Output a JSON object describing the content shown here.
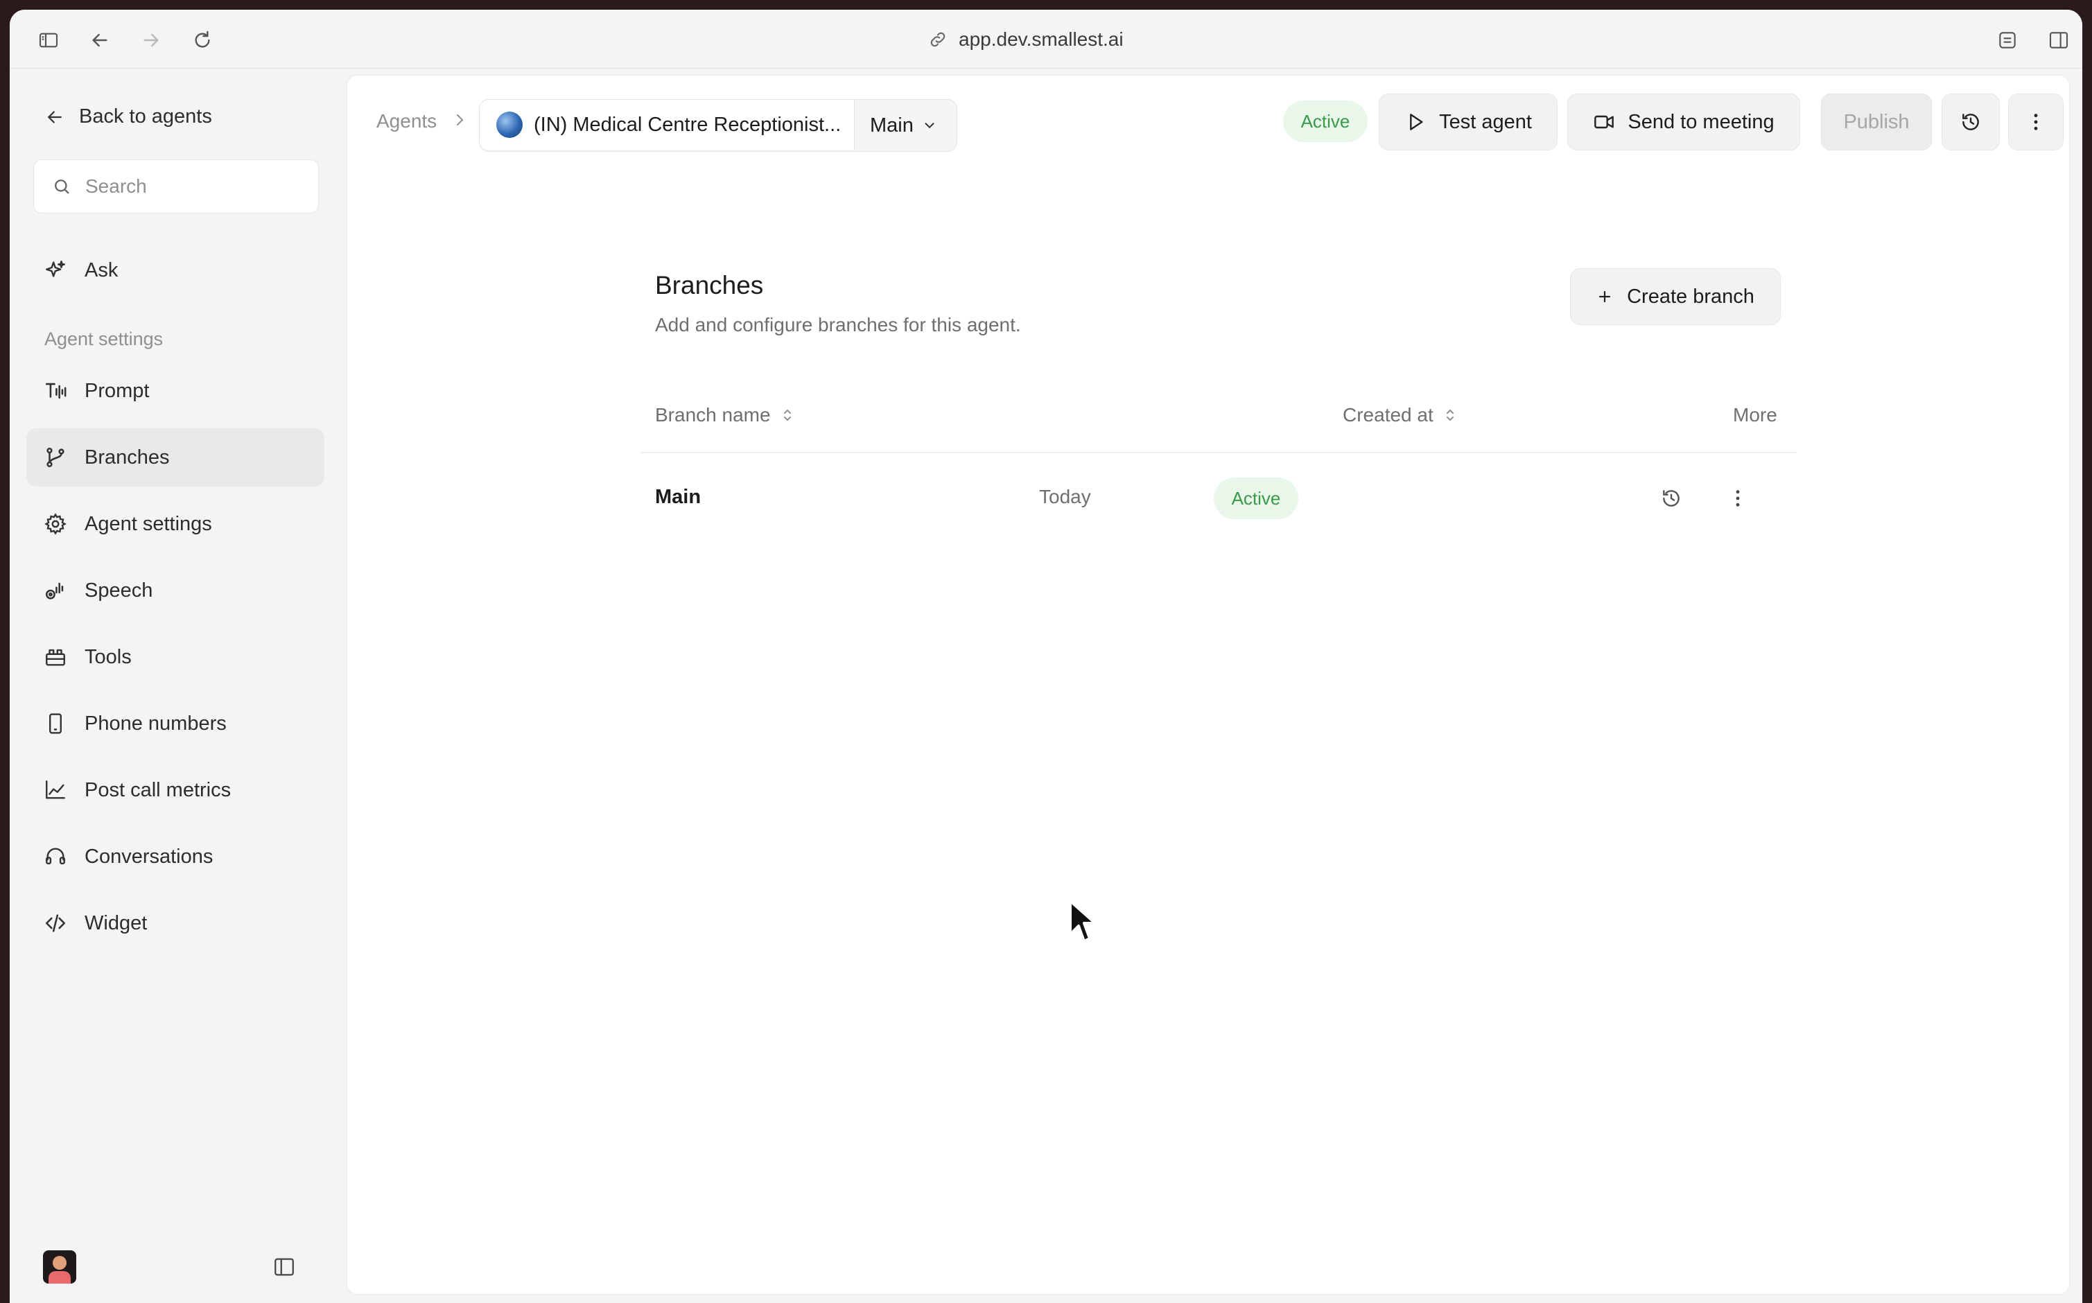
{
  "browser": {
    "url": "app.dev.smallest.ai"
  },
  "sidebar": {
    "back_label": "Back to agents",
    "search_placeholder": "Search",
    "ask_label": "Ask",
    "section_label": "Agent settings",
    "items": [
      {
        "label": "Prompt",
        "icon": "prompt-icon",
        "selected": false
      },
      {
        "label": "Branches",
        "icon": "branch-icon",
        "selected": true
      },
      {
        "label": "Agent settings",
        "icon": "gear-icon",
        "selected": false
      },
      {
        "label": "Speech",
        "icon": "speech-icon",
        "selected": false
      },
      {
        "label": "Tools",
        "icon": "tools-icon",
        "selected": false
      },
      {
        "label": "Phone numbers",
        "icon": "phone-icon",
        "selected": false
      },
      {
        "label": "Post call metrics",
        "icon": "chart-icon",
        "selected": false
      },
      {
        "label": "Conversations",
        "icon": "headset-icon",
        "selected": false
      },
      {
        "label": "Widget",
        "icon": "code-icon",
        "selected": false
      }
    ]
  },
  "header": {
    "breadcrumb_root": "Agents",
    "agent_name": "(IN) Medical Centre Receptionist...",
    "branch_selector": "Main",
    "status": "Active",
    "test_agent": "Test agent",
    "send_to_meeting": "Send to meeting",
    "publish": "Publish"
  },
  "branches": {
    "title": "Branches",
    "subtitle": "Add and configure branches for this agent.",
    "create_label": "Create branch",
    "columns": {
      "name": "Branch name",
      "created": "Created at",
      "more": "More"
    },
    "rows": [
      {
        "name": "Main",
        "status": "Active",
        "created": "Today"
      }
    ]
  },
  "colors": {
    "active_bg": "#e9f6ea",
    "active_text": "#3a9a4a",
    "selected_nav": "#e9e9ea"
  }
}
